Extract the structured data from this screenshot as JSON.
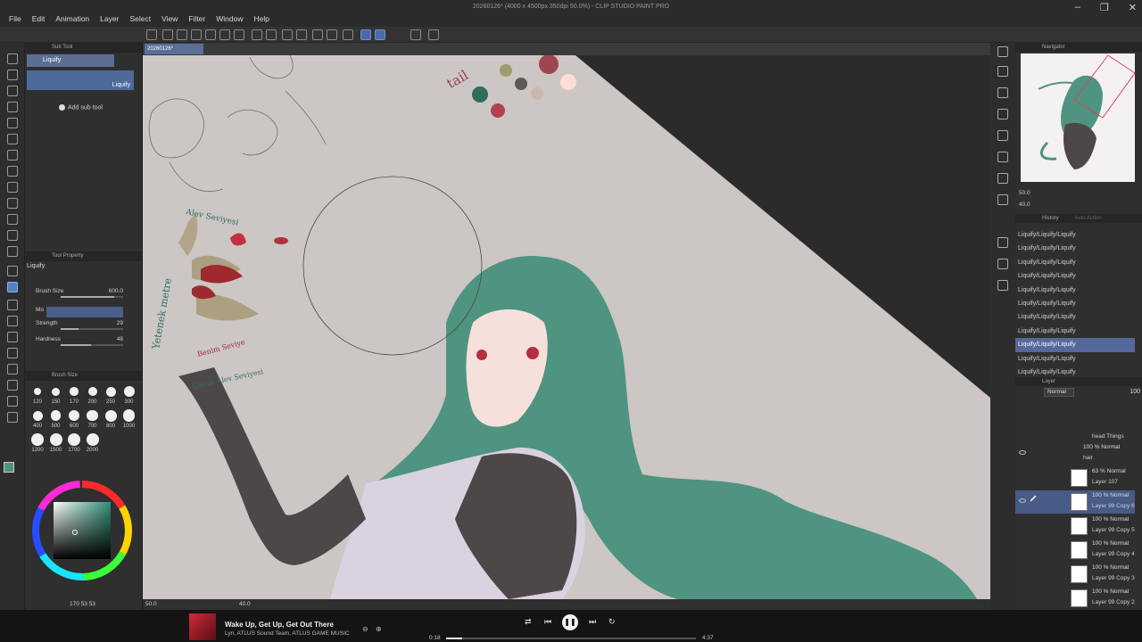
{
  "window": {
    "title": "20260126* (4000 x 4500px 350dpi 50.0%) - CLIP STUDIO PAINT PRO",
    "controls": [
      "–",
      "❐",
      "✕"
    ]
  },
  "menu": [
    "File",
    "Edit",
    "Animation",
    "Layer",
    "Select",
    "View",
    "Filter",
    "Window",
    "Help"
  ],
  "subtool": {
    "header": "Sub Tool",
    "tab_label": "Liquify",
    "item_label": "Liquify",
    "add_label": "Add sub tool"
  },
  "tool_property": {
    "header": "Tool Property",
    "name": "Liquify",
    "brush_size_label": "Brush Size",
    "brush_size_value": "600.0",
    "brush_size_level": 0.85,
    "mode_label": "Mo",
    "strength_label": "Strength",
    "strength_value": "29",
    "strength_level": 0.29,
    "hardness_label": "Hardness",
    "hardness_value": "48",
    "hardness_level": 0.48
  },
  "brush_size_panel": {
    "header": "Brush Size",
    "sizes": [
      "120",
      "150",
      "170",
      "200",
      "250",
      "300",
      "400",
      "500",
      "600",
      "700",
      "800",
      "1000",
      "1200",
      "1500",
      "1700",
      "2000"
    ]
  },
  "color": {
    "readout": "170  53  53",
    "main": "#4f9480"
  },
  "canvas": {
    "tab_label": "20260126*",
    "zoom": "50.0",
    "angle": "40.0",
    "annotations": {
      "color_note": "tail",
      "label_1": "Alev Seviyesi",
      "label_2": "Benim Seviye",
      "label_3": "Yetenek metre",
      "label_4": "Çocuk Alev Seviyesi"
    }
  },
  "navigator": {
    "header": "Navigator",
    "zoom": "50.0",
    "angle": "40.0"
  },
  "history": {
    "header": "History",
    "header_right": "Auto Action",
    "items": [
      "Liquify/Liquify/Liquify",
      "Liquify/Liquify/Liquify",
      "Liquify/Liquify/Liquify",
      "Liquify/Liquify/Liquify",
      "Liquify/Liquify/Liquify",
      "Liquify/Liquify/Liquify",
      "Liquify/Liquify/Liquify",
      "Liquify/Liquify/Liquify",
      "Liquify/Liquify/Liquify",
      "Liquify/Liquify/Liquify",
      "Liquify/Liquify/Liquify"
    ],
    "selected_index": 8
  },
  "layers": {
    "header": "Layer",
    "blend_mode": "Normal",
    "opacity": "100",
    "rows": [
      {
        "mode": "",
        "name": "head Things"
      },
      {
        "mode": "100 % Normal",
        "name": "hair"
      },
      {
        "mode": "63 % Normal",
        "name": "Layer 107"
      },
      {
        "mode": "100 % Normal",
        "name": "Layer 99 Copy 6"
      },
      {
        "mode": "100 % Normal",
        "name": "Layer 99 Copy 5"
      },
      {
        "mode": "100 % Normal",
        "name": "Layer 99 Copy 4"
      },
      {
        "mode": "100 % Normal",
        "name": "Layer 99 Copy 3"
      },
      {
        "mode": "100 % Normal",
        "name": "Layer 99 Copy 2"
      },
      {
        "mode": "100 % Normal",
        "name": ""
      }
    ],
    "selected_index": 3
  },
  "media": {
    "title": "Wake Up, Get Up, Get Out There",
    "artist": "Lyn, ATLUS Sound Team, ATLUS GAME MUSIC",
    "time_current": "0:18",
    "time_total": "4:37",
    "progress": 0.065
  }
}
